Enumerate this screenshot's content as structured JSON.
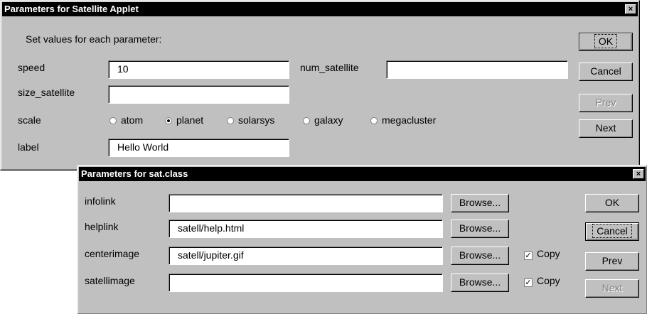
{
  "dialog1": {
    "title": "Parameters for Satellite Applet",
    "close": "×",
    "instructions": "Set values for each parameter:",
    "labels": {
      "speed": "speed",
      "num_satellite": "num_satellite",
      "size_satellite": "size_satellite",
      "scale": "scale",
      "label": "label"
    },
    "values": {
      "speed": "10",
      "num_satellite": "",
      "size_satellite": "",
      "label": "Hello World"
    },
    "scale_options": [
      {
        "label": "atom",
        "selected": false
      },
      {
        "label": "planet",
        "selected": true
      },
      {
        "label": "solarsys",
        "selected": false
      },
      {
        "label": "galaxy",
        "selected": false
      },
      {
        "label": "megacluster",
        "selected": false
      }
    ],
    "buttons": {
      "ok": "OK",
      "cancel": "Cancel",
      "prev": "Prev",
      "next": "Next"
    }
  },
  "dialog2": {
    "title": "Parameters for sat.class",
    "close": "×",
    "rows": [
      {
        "label": "infolink",
        "value": "",
        "browse": "Browse...",
        "copy": null
      },
      {
        "label": "helplink",
        "value": "satell/help.html",
        "browse": "Browse...",
        "copy": null
      },
      {
        "label": "centerimage",
        "value": "satell/jupiter.gif",
        "browse": "Browse...",
        "copy": {
          "label": "Copy",
          "checked": true
        }
      },
      {
        "label": "satellimage",
        "value": "",
        "browse": "Browse...",
        "copy": {
          "label": "Copy",
          "checked": true
        }
      }
    ],
    "buttons": {
      "ok": "OK",
      "cancel": "Cancel",
      "prev": "Prev",
      "next": "Next"
    }
  }
}
